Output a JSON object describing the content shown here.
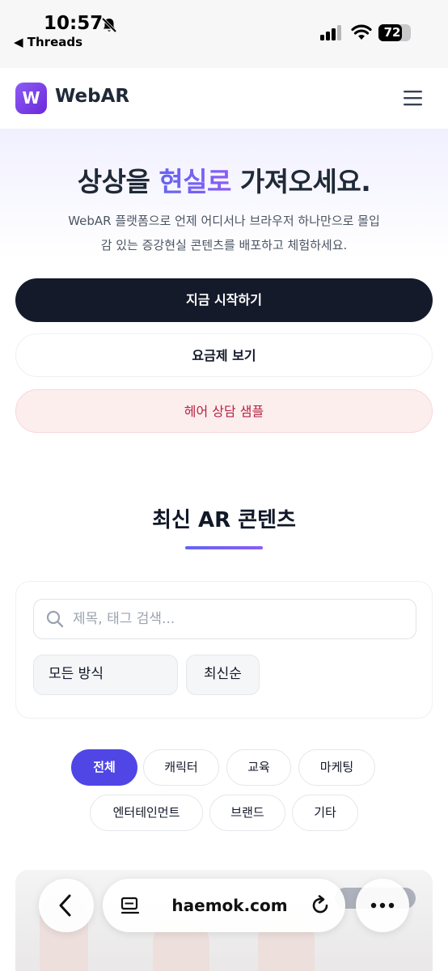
{
  "status": {
    "time": "10:57",
    "back_app": "◀ Threads",
    "battery": "72",
    "battery_level": 0.72
  },
  "header": {
    "logo_letter": "W",
    "logo_text": "WebAR",
    "menu_icon": "hamburger-icon"
  },
  "hero": {
    "title_before": "상상을 ",
    "title_accent": "현실로",
    "title_after": " 가져오세요.",
    "description": "WebAR 플랫폼으로 언제 어디서나 브라우저 하나만으로 몰입감 있는 증강현실 콘텐츠를 배포하고 체험하세요.",
    "primary_button": "지금 시작하기",
    "secondary_button": "요금제 보기",
    "sample_button": "헤어 상담 샘플"
  },
  "section": {
    "title": "최신 AR 콘텐츠"
  },
  "filters": {
    "search_placeholder": "제목, 태그 검색...",
    "method_select": "모든 방식",
    "sort_select": "최신순"
  },
  "categories": [
    "전체",
    "캐릭터",
    "교육",
    "마케팅",
    "엔터테인먼트",
    "브랜드",
    "기타"
  ],
  "browser": {
    "url": "haemok.com"
  },
  "colors": {
    "accent": "#4f46e5",
    "primary_button": "#151a2b",
    "sample_text": "#b42342"
  }
}
